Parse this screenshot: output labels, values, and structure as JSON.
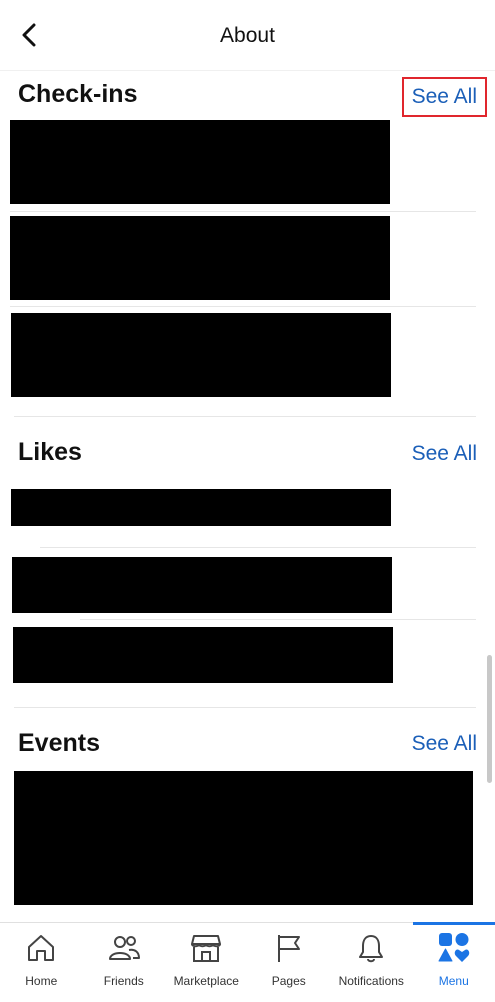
{
  "header": {
    "title": "About"
  },
  "sections": {
    "checkins": {
      "title": "Check-ins",
      "see_all": "See All"
    },
    "likes": {
      "title": "Likes",
      "see_all": "See All"
    },
    "events": {
      "title": "Events",
      "see_all": "See All"
    }
  },
  "tabbar": {
    "home": "Home",
    "friends": "Friends",
    "marketplace": "Marketplace",
    "pages": "Pages",
    "notifications": "Notifications",
    "menu": "Menu"
  },
  "colors": {
    "accent": "#1b74e4",
    "link": "#1b5fb8",
    "highlight": "#e0262d"
  }
}
